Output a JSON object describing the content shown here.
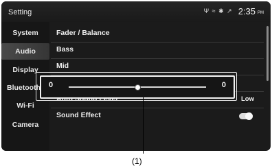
{
  "header": {
    "title": "Setting",
    "status_icons": "Ψ ≈ ✱ ↗",
    "time": "2:35",
    "ampm": "PM"
  },
  "sidebar": {
    "items": [
      {
        "label": "System",
        "active": false
      },
      {
        "label": "Audio",
        "active": true
      },
      {
        "label": "Display",
        "active": false
      },
      {
        "label": "Bluetooth",
        "active": false
      },
      {
        "label": "Wi-Fi",
        "active": false
      },
      {
        "label": "Camera",
        "active": false
      }
    ]
  },
  "menu": {
    "rows": [
      {
        "label": "Fader / Balance",
        "value": ""
      },
      {
        "label": "Bass",
        "value": ""
      },
      {
        "label": "Mid",
        "value": ""
      },
      {
        "label": "",
        "value": ""
      },
      {
        "label": "Auto Sound Level",
        "value": "Low"
      },
      {
        "label": "Sound Effect",
        "value": ""
      }
    ]
  },
  "sound_effect": {
    "enabled": true
  },
  "slider": {
    "left_value": "0",
    "right_value": "0",
    "level": 0.5
  },
  "annotation": {
    "caption": "(1)"
  }
}
